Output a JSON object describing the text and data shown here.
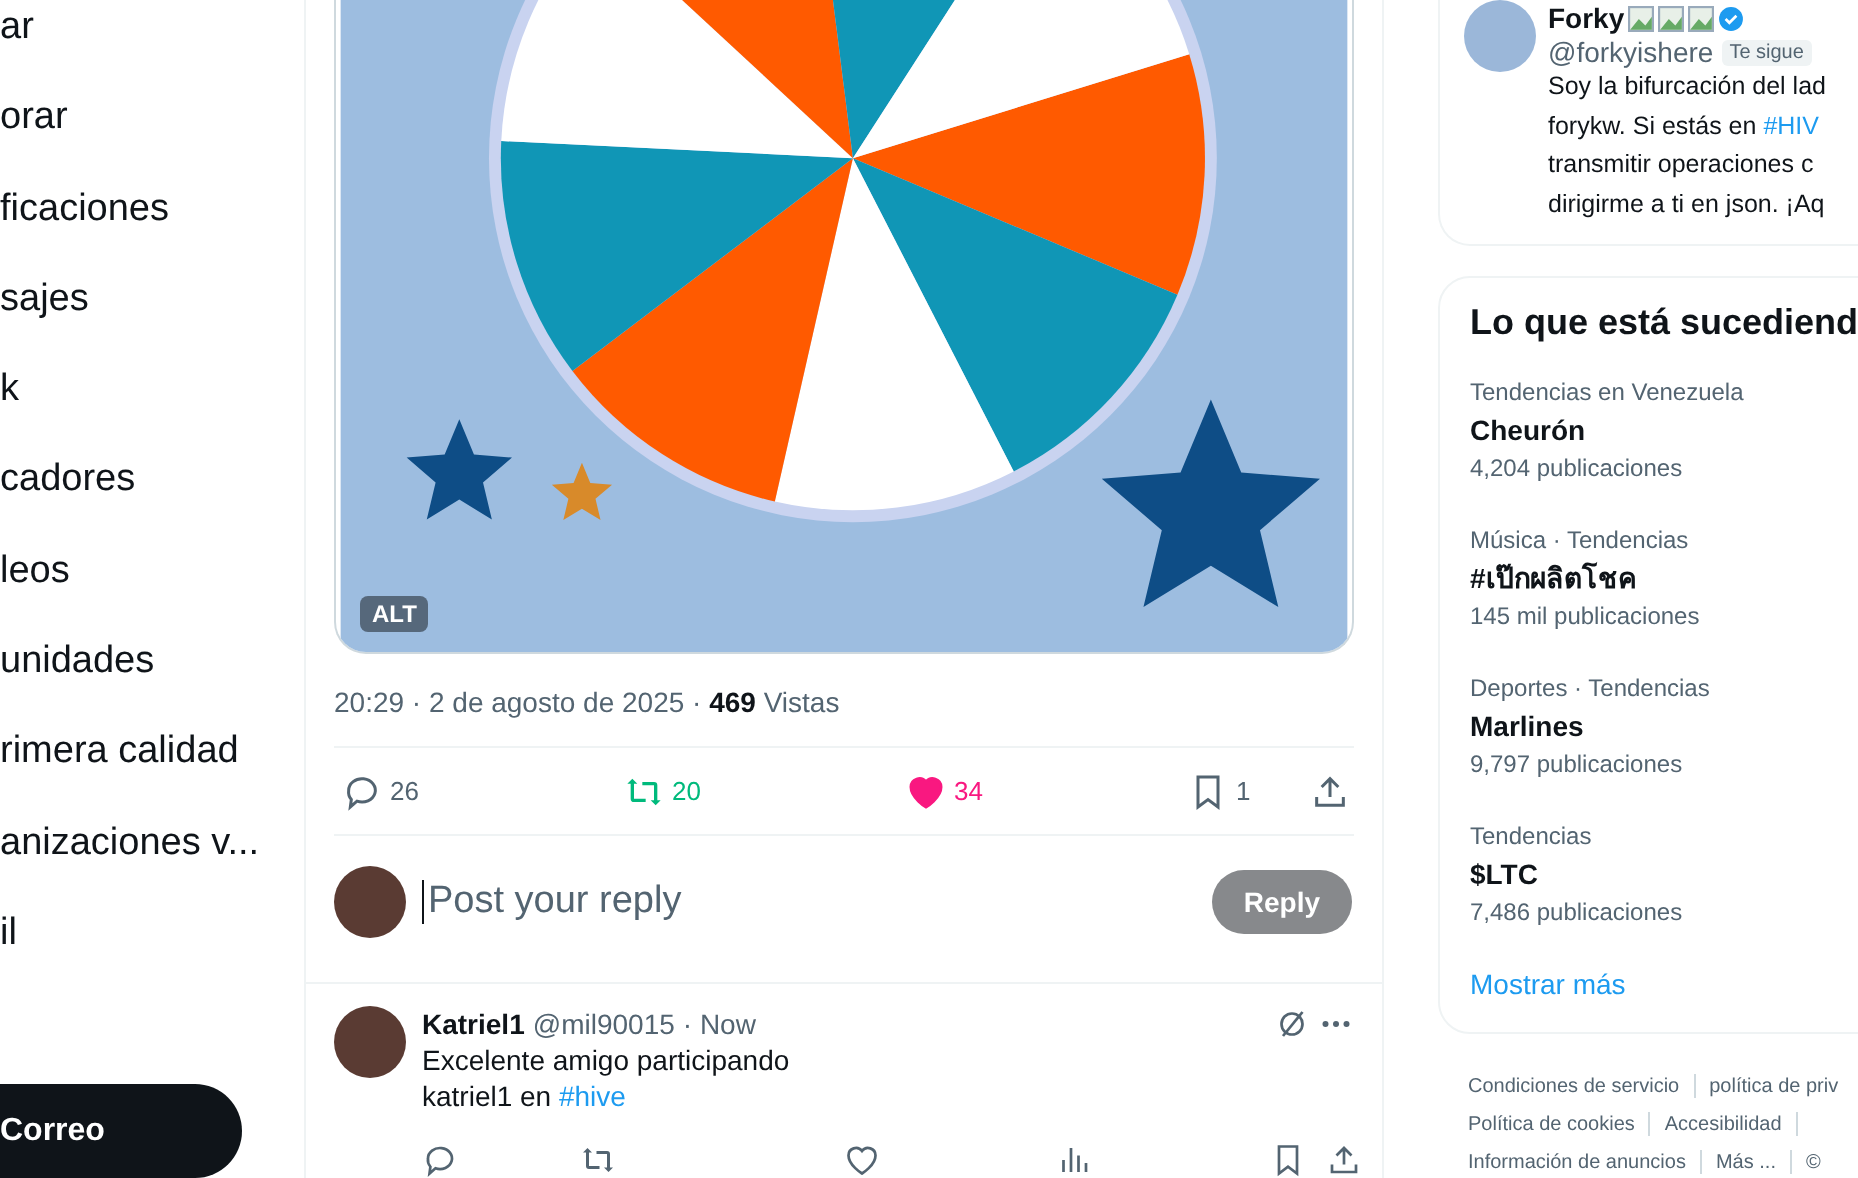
{
  "sidebar": {
    "items": [
      "ar",
      "orar",
      "ficaciones",
      "sajes",
      "k",
      "cadores",
      "leos",
      "unidades",
      "rimera calidad",
      "anizaciones v...",
      "il"
    ],
    "post_button": "Correo"
  },
  "post": {
    "media": {
      "alt_badge": "ALT"
    },
    "time": "20:29 · 2 de agosto de 2025 · ",
    "views_count": "469",
    "views_label": " Vistas",
    "actions": {
      "replies": "26",
      "reposts": "20",
      "reposted": true,
      "likes": "34",
      "liked": true,
      "bookmarks": "1",
      "bookmarked": false
    }
  },
  "compose": {
    "placeholder": "Post your reply",
    "button": "Reply",
    "disabled": true
  },
  "replies": [
    {
      "name": "Katriel1",
      "handle": "@mil90015",
      "time": "· Now",
      "lines": [
        {
          "text": "Excelente amigo participando"
        },
        {
          "text": "katriel1 en ",
          "link": "#hive"
        }
      ]
    }
  ],
  "profile_card": {
    "name": "Forky",
    "handle": "@forkyishere",
    "badge": "Te sigue",
    "verified": true,
    "bio": [
      {
        "text": "Soy la bifurcación del lad"
      },
      {
        "text": "forykw. Si estás en ",
        "link": "#HIV"
      },
      {
        "text": "transmitir operaciones c"
      },
      {
        "text": "dirigirme a ti en json. ¡Aq"
      }
    ]
  },
  "trends": {
    "title": "Lo que está sucediend",
    "items": [
      {
        "context": "Tendencias en Venezuela",
        "name": "Cheurón",
        "count": "4,204 publicaciones"
      },
      {
        "context": "Música · Tendencias",
        "name": "#เป๊กผลิตโชค",
        "count": "145 mil publicaciones"
      },
      {
        "context": "Deportes · Tendencias",
        "name": "Marlines",
        "count": "9,797 publicaciones"
      },
      {
        "context": "Tendencias",
        "name": "$LTC",
        "count": "7,486 publicaciones"
      }
    ],
    "more": "Mostrar más"
  },
  "footer_links": [
    [
      "Condiciones de servicio",
      "política de priv"
    ],
    [
      "Política de cookies",
      "Accesibilidad"
    ],
    [
      "Información de anuncios",
      "Más ...",
      "©"
    ]
  ]
}
